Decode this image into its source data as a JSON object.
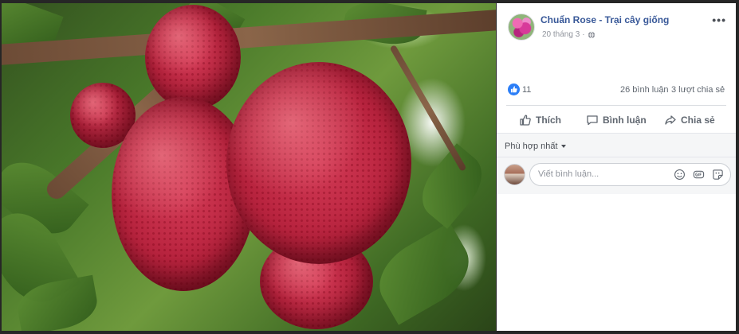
{
  "post": {
    "page_name": "Chuẩn Rose - Trại cây giống",
    "date": "20 tháng 3",
    "privacy_icon": "globe-icon",
    "more_label": "•••"
  },
  "photo": {
    "subject_icon": "jackfruit-photo"
  },
  "stats": {
    "like_icon": "like-reaction-icon",
    "like_count": "11",
    "comments": "26 bình luận",
    "shares": "3 lượt chia sẻ"
  },
  "actions": {
    "like": "Thích",
    "comment": "Bình luận",
    "share": "Chia sẻ"
  },
  "comments": {
    "sort_label": "Phù hợp nhất",
    "input_placeholder": "Viết bình luận...",
    "composer_icons": [
      "emoji-icon",
      "gif-icon",
      "sticker-icon"
    ]
  },
  "colors": {
    "link_blue": "#385898",
    "like_blue": "#2c7ff7",
    "muted_text": "#606770"
  }
}
